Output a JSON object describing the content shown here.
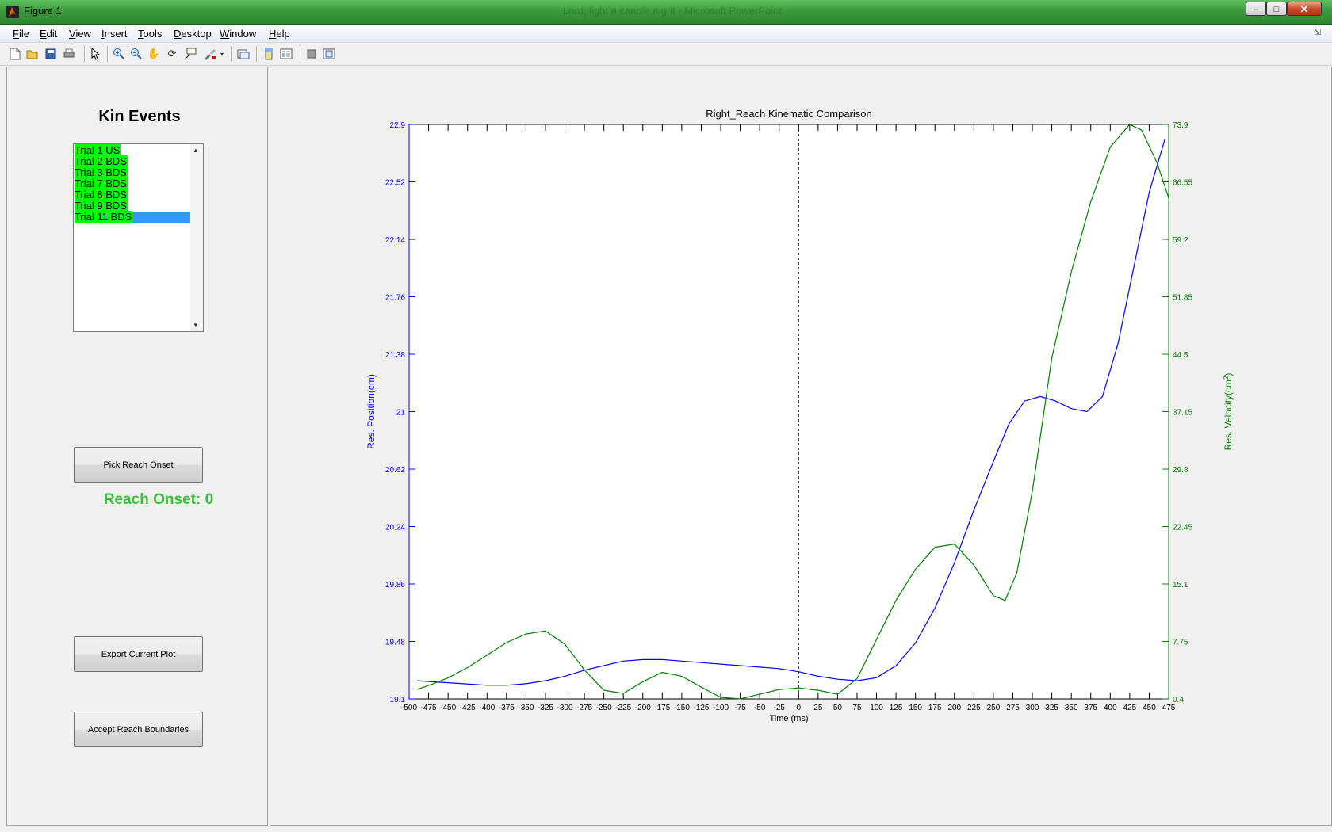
{
  "window": {
    "title": "Figure 1",
    "ghost_title": "Lord, light a candle night - Microsoft PowerPoint",
    "minimize": "–",
    "maximize": "□",
    "close": "✕"
  },
  "menu": [
    "File",
    "Edit",
    "View",
    "Insert",
    "Tools",
    "Desktop",
    "Window",
    "Help"
  ],
  "toolbar": [
    "new-figure-icon",
    "open-file-icon",
    "save-icon",
    "print-icon",
    "edit-plot-arrow-icon",
    "zoom-in-icon",
    "zoom-out-icon",
    "pan-hand-icon",
    "rotate-3d-icon",
    "data-cursor-icon",
    "brush-icon",
    "link-plot-icon",
    "colorbar-icon",
    "legend-icon",
    "hide-plot-tools-icon",
    "show-plot-tools-icon"
  ],
  "left_panel": {
    "title": "Kin Events",
    "trials": [
      "Trial 1 US",
      "Trial 2 BDS",
      "Trial 3 BDS",
      "Trial 7 BDS",
      "Trial 8 BDS",
      "Trial 9 BDS",
      "Trial 11 BDS"
    ],
    "selected_index": 6,
    "pick_button": "Pick Reach Onset",
    "onset_text": "Reach Onset: 0",
    "export_button": "Export Current Plot",
    "accept_button": "Accept Reach Boundaries"
  },
  "colors": {
    "position_series": "#0000ff",
    "velocity_series": "#008000",
    "onset_label": "#3cc03c",
    "list_highlight": "#00ff00",
    "selection": "#3399ff",
    "titlebar": "#3c9a3c"
  },
  "chart_data": {
    "type": "line",
    "title": "Right_Reach Kinematic Comparison",
    "xlabel": "Time (ms)",
    "ylabel_left": "Res. Position(cm)",
    "ylabel_right_prefix": "Res. Velocity(cm",
    "ylabel_right_sup": "2",
    "ylabel_right_suffix": ")",
    "xlim": [
      -500,
      475
    ],
    "ylim_left": [
      19.1,
      22.9
    ],
    "ylim_right": [
      0.4,
      73.9
    ],
    "x_ticks": [
      -500,
      -475,
      -450,
      -425,
      -400,
      -375,
      -350,
      -325,
      -300,
      -275,
      -250,
      -225,
      -200,
      -175,
      -150,
      -125,
      -100,
      -75,
      -50,
      -25,
      0,
      25,
      50,
      75,
      100,
      125,
      150,
      175,
      200,
      225,
      250,
      275,
      300,
      325,
      350,
      375,
      400,
      425,
      450,
      475
    ],
    "y_ticks_left": [
      "19.1",
      "19.48",
      "19.86",
      "20.24",
      "20.62",
      "21",
      "21.38",
      "21.76",
      "22.14",
      "22.52",
      "22.9"
    ],
    "y_ticks_right": [
      "0.4",
      "7.75",
      "15.1",
      "22.45",
      "29.8",
      "37.15",
      "44.5",
      "51.85",
      "59.2",
      "66.55",
      "73.9"
    ],
    "onset_marker_x": 0,
    "grid": false,
    "series": [
      {
        "axis": "left",
        "x": [
          -490,
          -460,
          -430,
          -400,
          -375,
          -350,
          -325,
          -300,
          -275,
          -250,
          -225,
          -200,
          -175,
          -150,
          -125,
          -100,
          -75,
          -50,
          -25,
          0,
          25,
          50,
          75,
          100,
          125,
          150,
          175,
          200,
          225,
          250,
          270,
          290,
          310,
          330,
          350,
          370,
          390,
          410,
          430,
          450,
          470
        ],
        "values": [
          19.22,
          19.21,
          19.2,
          19.19,
          19.19,
          19.2,
          19.22,
          19.25,
          19.29,
          19.32,
          19.35,
          19.36,
          19.36,
          19.35,
          19.34,
          19.33,
          19.32,
          19.31,
          19.3,
          19.28,
          19.25,
          19.23,
          19.22,
          19.24,
          19.32,
          19.47,
          19.7,
          20.0,
          20.35,
          20.67,
          20.92,
          21.07,
          21.1,
          21.07,
          21.02,
          21.0,
          21.1,
          21.45,
          21.95,
          22.45,
          22.8
        ]
      },
      {
        "axis": "right",
        "x": [
          -490,
          -470,
          -450,
          -425,
          -400,
          -375,
          -350,
          -325,
          -300,
          -275,
          -250,
          -225,
          -200,
          -175,
          -150,
          -125,
          -100,
          -75,
          -50,
          -25,
          0,
          25,
          50,
          75,
          100,
          125,
          150,
          175,
          200,
          225,
          250,
          265,
          280,
          300,
          325,
          350,
          375,
          400,
          425,
          440,
          460,
          475
        ],
        "values": [
          1.6,
          2.3,
          3.1,
          4.4,
          6.0,
          7.6,
          8.7,
          9.1,
          7.4,
          4.1,
          1.5,
          1.1,
          2.6,
          3.8,
          3.3,
          1.9,
          0.6,
          0.4,
          1.0,
          1.6,
          1.8,
          1.5,
          1.0,
          3.0,
          8.0,
          13.0,
          17.0,
          19.8,
          20.2,
          17.5,
          13.6,
          13.0,
          16.5,
          27.0,
          44.0,
          55.0,
          64.0,
          71.0,
          73.9,
          73.2,
          69.0,
          64.5
        ]
      }
    ]
  }
}
